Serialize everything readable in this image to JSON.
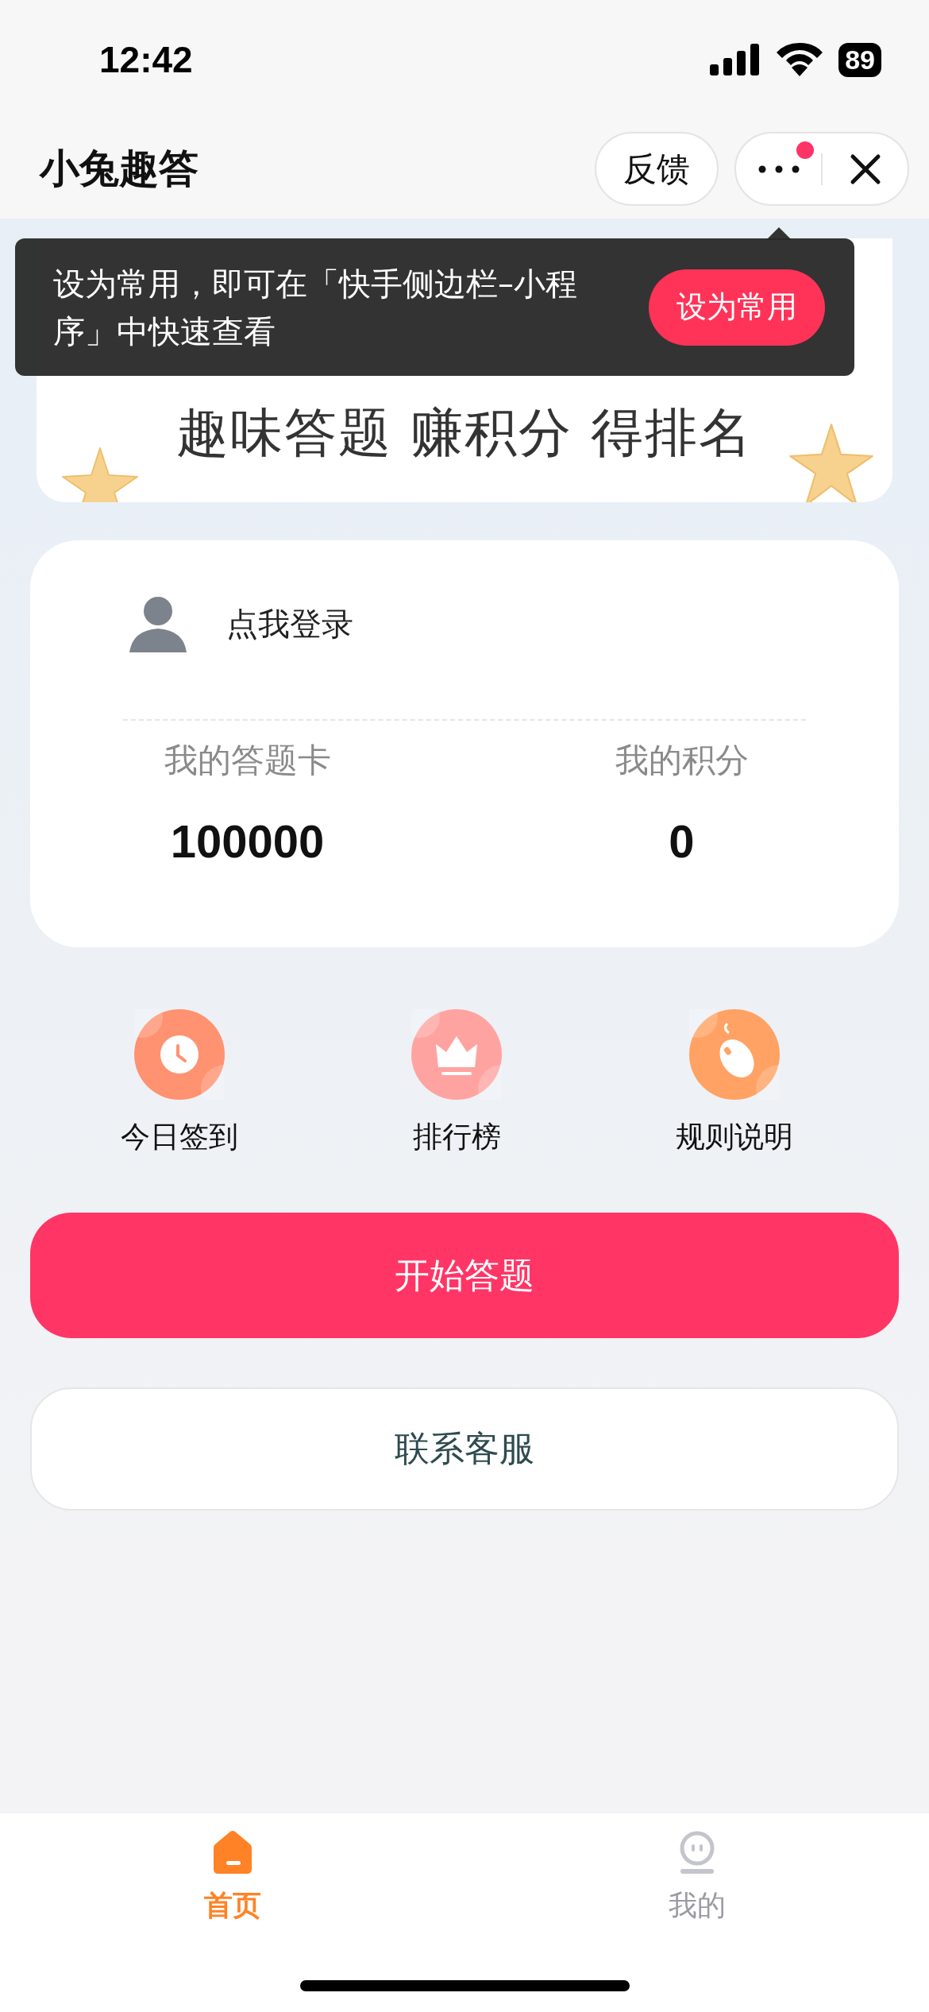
{
  "status_bar": {
    "time": "12:42",
    "battery": "89"
  },
  "nav_bar": {
    "title": "小兔趣答",
    "feedback": "反馈",
    "has_notification": true
  },
  "tip": {
    "text": "设为常用，即可在「快手侧边栏–小程序」中快速查看",
    "button": "设为常用"
  },
  "banner": {
    "title": "趣味答题 赚积分 得排名"
  },
  "user_card": {
    "login": "点我登录",
    "stats": [
      {
        "label": "我的答题卡",
        "value": "100000"
      },
      {
        "label": "我的积分",
        "value": "0"
      }
    ]
  },
  "shortcuts": [
    {
      "label": "今日签到",
      "kind": "clock",
      "color": "#ff9271"
    },
    {
      "label": "排行榜",
      "kind": "crown",
      "color": "#ffa3a1"
    },
    {
      "label": "规则说明",
      "kind": "mouse",
      "color": "#ffa263"
    }
  ],
  "primary_button": "开始答题",
  "secondary_button": "联系客服",
  "tab_bar": [
    {
      "label": "首页",
      "kind": "home",
      "selected": true
    },
    {
      "label": "我的",
      "kind": "profile",
      "selected": false
    }
  ]
}
